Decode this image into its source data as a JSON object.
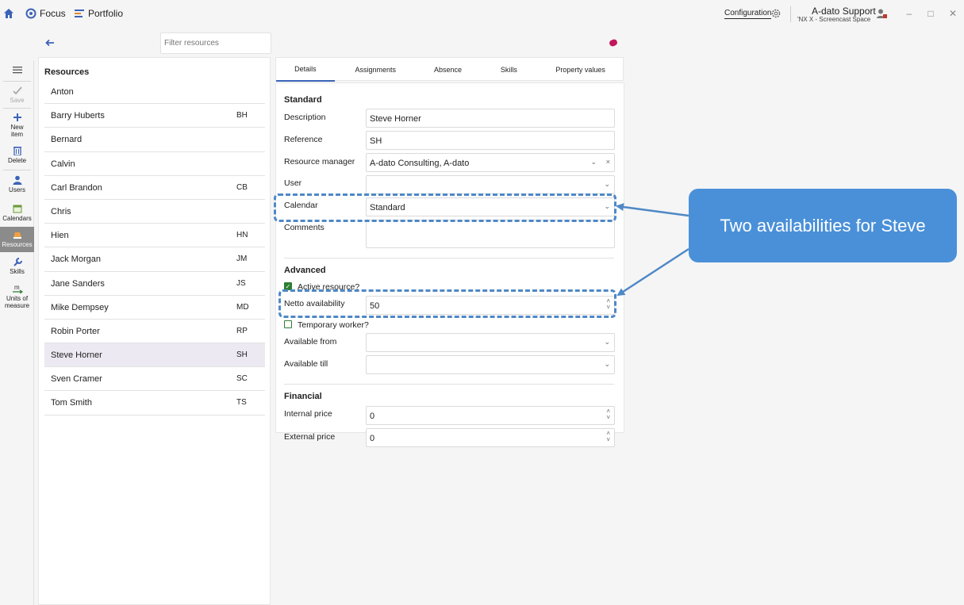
{
  "topbar": {
    "nav_focus": "Focus",
    "nav_portfolio": "Portfolio",
    "configuration": "Configuration",
    "user_name": "A-dato Support",
    "user_space": "'NX X - Screencast Space"
  },
  "filter": {
    "placeholder": "Filter resources"
  },
  "rail": {
    "save": "Save",
    "new_item": "New item",
    "delete": "Delete",
    "users": "Users",
    "calendars": "Calendars",
    "resources": "Resources",
    "skills": "Skills",
    "units_of_measure": "Units of measure"
  },
  "resources": {
    "title": "Resources",
    "items": [
      {
        "name": "Anton",
        "initials": ""
      },
      {
        "name": "Barry Huberts",
        "initials": "BH"
      },
      {
        "name": "Bernard",
        "initials": ""
      },
      {
        "name": "Calvin",
        "initials": ""
      },
      {
        "name": "Carl Brandon",
        "initials": "CB"
      },
      {
        "name": "Chris",
        "initials": ""
      },
      {
        "name": "Hien",
        "initials": "HN"
      },
      {
        "name": "Jack Morgan",
        "initials": "JM"
      },
      {
        "name": "Jane Sanders",
        "initials": "JS"
      },
      {
        "name": "Mike Dempsey",
        "initials": "MD"
      },
      {
        "name": "Robin Porter",
        "initials": "RP"
      },
      {
        "name": "Steve Horner",
        "initials": "SH"
      },
      {
        "name": "Sven Cramer",
        "initials": "SC"
      },
      {
        "name": "Tom Smith",
        "initials": "TS"
      }
    ],
    "selected": "Steve Horner"
  },
  "tabs": [
    "Details",
    "Assignments",
    "Absence",
    "Skills",
    "Property values"
  ],
  "details": {
    "standard": {
      "heading": "Standard",
      "description_label": "Description",
      "description_value": "Steve Horner",
      "reference_label": "Reference",
      "reference_value": "SH",
      "resource_manager_label": "Resource manager",
      "resource_manager_value": "A-dato Consulting, A-dato",
      "user_label": "User",
      "user_value": "",
      "calendar_label": "Calendar",
      "calendar_value": "Standard",
      "comments_label": "Comments",
      "comments_value": ""
    },
    "advanced": {
      "heading": "Advanced",
      "active_label": "Active resource?",
      "active_checked": true,
      "netto_label": "Netto availability",
      "netto_value": "50",
      "temporary_label": "Temporary worker?",
      "temporary_checked": false,
      "available_from_label": "Available from",
      "available_from_value": "",
      "available_till_label": "Available till",
      "available_till_value": ""
    },
    "financial": {
      "heading": "Financial",
      "internal_label": "Internal price",
      "internal_value": "0",
      "external_label": "External price",
      "external_value": "0"
    }
  },
  "callout": {
    "text": "Two availabilities for Steve"
  },
  "colors": {
    "accent": "#3b63b8",
    "callout": "#4a90d9",
    "check": "#2e7d32"
  }
}
